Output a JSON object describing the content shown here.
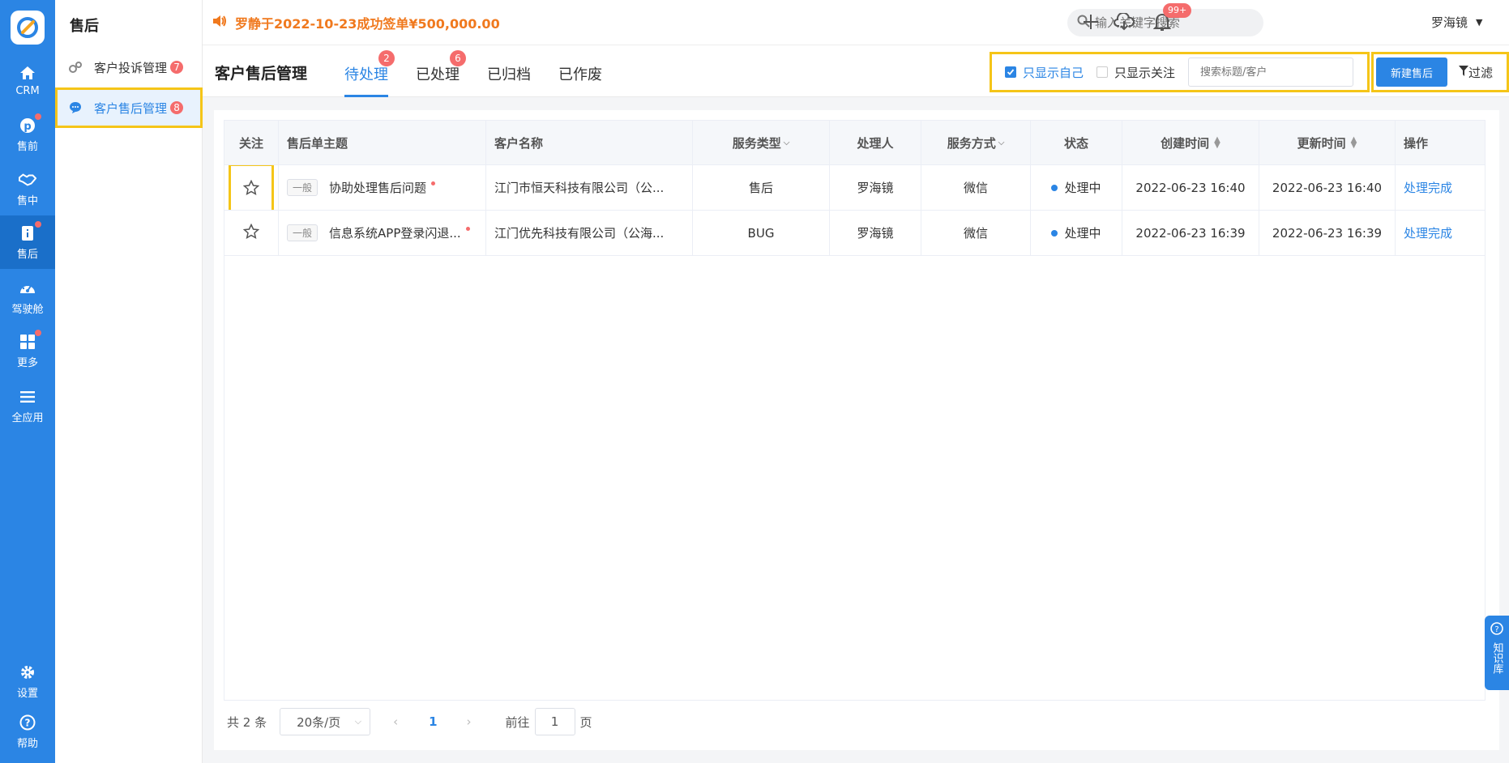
{
  "rail": {
    "items": [
      {
        "label": "CRM",
        "icon": "home-icon"
      },
      {
        "label": "售前",
        "icon": "pinterest-icon",
        "dot": true
      },
      {
        "label": "售中",
        "icon": "handshake-icon"
      },
      {
        "label": "售后",
        "icon": "document-icon",
        "dot": true,
        "active": true
      },
      {
        "label": "驾驶舱",
        "icon": "dashboard-icon"
      },
      {
        "label": "更多",
        "icon": "grid-icon",
        "dot": true
      },
      {
        "label": "全应用",
        "icon": "menu-icon"
      },
      {
        "label": "设置",
        "icon": "gear-icon"
      },
      {
        "label": "帮助",
        "icon": "help-icon"
      }
    ]
  },
  "subnav": {
    "title": "售后",
    "items": [
      {
        "label": "客户投诉管理",
        "badge": "7"
      },
      {
        "label": "客户售后管理",
        "badge": "8"
      }
    ]
  },
  "topbar": {
    "announcement": "罗静于2022-10-23成功签单¥500,000.00",
    "search_placeholder": "输入关键字搜索",
    "bell_badge": "99+",
    "user_name": "罗海镜"
  },
  "page": {
    "title": "客户售后管理",
    "tabs": [
      {
        "label": "待处理",
        "badge": "2"
      },
      {
        "label": "已处理",
        "badge": "6"
      },
      {
        "label": "已归档"
      },
      {
        "label": "已作废"
      }
    ],
    "filter_only_mine": "只显示自己",
    "filter_only_followed": "只显示关注",
    "search_placeholder": "搜索标题/客户",
    "new_button": "新建售后",
    "filter_button": "过滤"
  },
  "table": {
    "headers": [
      "关注",
      "售后单主题",
      "客户名称",
      "服务类型",
      "处理人",
      "服务方式",
      "状态",
      "创建时间",
      "更新时间",
      "操作"
    ],
    "rows": [
      {
        "level": "一般",
        "subject": "协助处理售后问题",
        "customer": "江门市恒天科技有限公司（公...",
        "type": "售后",
        "handler": "罗海镜",
        "method": "微信",
        "status": "处理中",
        "created": "2022-06-23 16:40",
        "updated": "2022-06-23 16:40",
        "action": "处理完成"
      },
      {
        "level": "一般",
        "subject": "信息系统APP登录闪退...",
        "customer": "江门优先科技有限公司（公海...",
        "type": "BUG",
        "handler": "罗海镜",
        "method": "微信",
        "status": "处理中",
        "created": "2022-06-23 16:39",
        "updated": "2022-06-23 16:39",
        "action": "处理完成"
      }
    ]
  },
  "pager": {
    "total": "共 2 条",
    "page_size": "20条/页",
    "current_page": "1",
    "goto_label": "前往",
    "goto_value": "1",
    "page_unit": "页"
  },
  "kb": {
    "label": "知识库"
  },
  "colors": {
    "primary": "#2b85e4",
    "highlight": "#f5c518",
    "badge": "#f56c6c",
    "announce": "#f0791e"
  }
}
